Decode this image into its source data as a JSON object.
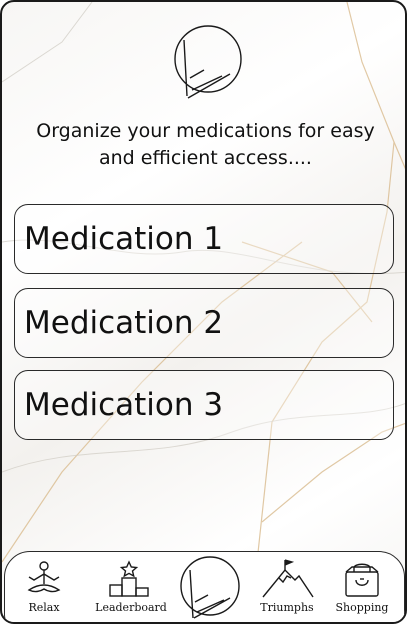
{
  "header": {
    "logo_icon": "brand-logo-icon",
    "subtitle_line1": "Organize your medications for easy",
    "subtitle_line2": "and efficient access...."
  },
  "medications": [
    {
      "label": "Medication 1"
    },
    {
      "label": "Medication 2"
    },
    {
      "label": "Medication 3"
    }
  ],
  "bottom_nav": {
    "items": [
      {
        "label": "Relax",
        "icon": "meditation-icon"
      },
      {
        "label": "Leaderboard",
        "icon": "podium-icon"
      },
      {
        "label": "",
        "icon": "brand-logo-icon"
      },
      {
        "label": "Triumphs",
        "icon": "mountain-flag-icon"
      },
      {
        "label": "Shopping",
        "icon": "shopping-bag-icon"
      }
    ]
  },
  "colors": {
    "stroke": "#1a1a1a",
    "marble_vein": "#d9b98a",
    "background": "#f7f6f4"
  }
}
